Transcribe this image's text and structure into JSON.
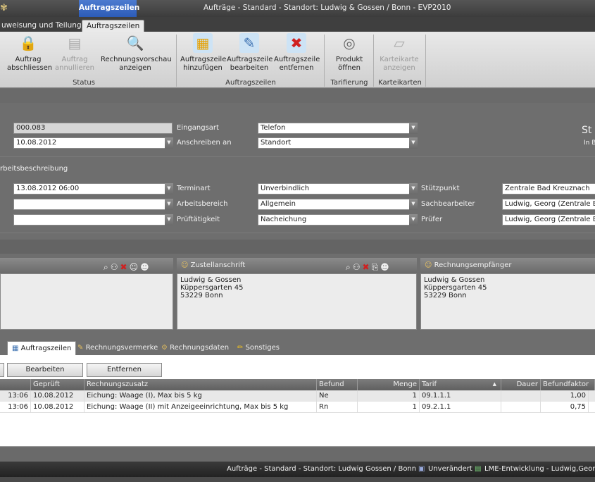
{
  "window": {
    "title": "Aufträge - Standard - Standort: Ludwig & Gossen / Bonn - EVP2010",
    "context_tab": "Auftragszeilen"
  },
  "ribbon_tabs": [
    {
      "label": "uweisung und Teilung"
    },
    {
      "label": "Auftragszeilen"
    }
  ],
  "ribbon": {
    "buttons": [
      {
        "label1": "Auftrag",
        "label2": "abschliessen"
      },
      {
        "label1": "Auftrag",
        "label2": "annullieren"
      },
      {
        "label1": "Rechnungsvorschau",
        "label2": "anzeigen"
      },
      {
        "label1": "Auftragszeile",
        "label2": "hinzufügen"
      },
      {
        "label1": "Auftragszeile",
        "label2": "bearbeiten"
      },
      {
        "label1": "Auftragszeile",
        "label2": "entfernen"
      },
      {
        "label1": "Produkt",
        "label2": "öffnen"
      },
      {
        "label1": "Karteikarte",
        "label2": "anzeigen"
      }
    ],
    "groups": [
      "Status",
      "Auftragszeilen",
      "Tarifierung",
      "Karteikarten"
    ]
  },
  "form": {
    "order_number": "000.083",
    "date": "10.08.2012",
    "eingangsart_label": "Eingangsart",
    "eingangsart_value": "Telefon",
    "anschreiben_label": "Anschreiben an",
    "anschreiben_value": "Standort",
    "status_title": "St",
    "status_sub": "In B",
    "section_title": "rbeitsbeschreibung",
    "termin_value": "13.08.2012 06:00",
    "terminart_label": "Terminart",
    "terminart_value": "Unverbindlich",
    "arbeitsbereich_label": "Arbeitsbereich",
    "arbeitsbereich_value": "Allgemein",
    "pruef_label": "Prüftätigkeit",
    "pruef_value": "Nacheichung",
    "stuetzpunkt_label": "Stützpunkt",
    "stuetzpunkt_value": "Zentrale Bad Kreuznach",
    "sachbearbeiter_label": "Sachbearbeiter",
    "sachbearbeiter_value": "Ludwig, Georg (Zentrale Bad",
    "pruefer_label": "Prüfer",
    "pruefer_value": "Ludwig, Georg (Zentrale Bad"
  },
  "address_panels": {
    "zustell_title": "Zustellanschrift",
    "zustell_lines": [
      "Ludwig & Gossen",
      "Küppersgarten 45",
      "53229 Bonn"
    ],
    "rechnung_title": "Rechnungsempfänger",
    "rechnung_lines": [
      "Ludwig & Gossen",
      "Küppersgarten 45",
      "53229 Bonn"
    ]
  },
  "bottom_tabs": [
    {
      "label": "Auftragszeilen"
    },
    {
      "label": "Rechnungsvermerke"
    },
    {
      "label": "Rechnungsdaten"
    },
    {
      "label": "Sonstiges"
    }
  ],
  "line_buttons": {
    "edit": "Bearbeiten",
    "remove": "Entfernen"
  },
  "grid": {
    "headers": [
      "Geprüft",
      "Rechnungszusatz",
      "Befund",
      "Menge",
      "Tarif",
      "Dauer",
      "Befundfaktor"
    ],
    "rows": [
      {
        "time": "13:06",
        "geprueft": "10.08.2012",
        "zusatz": "Eichung: Waage (I), Max bis 5 kg",
        "befund": "Ne",
        "menge": "1",
        "tarif": "09.1.1.1",
        "dauer": "",
        "faktor": "1,00"
      },
      {
        "time": "13:06",
        "geprueft": "10.08.2012",
        "zusatz": "Eichung: Waage (II) mit Anzeigeeinrichtung, Max bis 5 kg",
        "befund": "Rn",
        "menge": "1",
        "tarif": "09.2.1.1",
        "dauer": "",
        "faktor": "0,75"
      }
    ]
  },
  "statusbar": {
    "context": "Aufträge - Standard - Standort: Ludwig  Gossen / Bonn",
    "state": "Unverändert",
    "env": "LME-Entwicklung - Ludwig,Georg"
  }
}
